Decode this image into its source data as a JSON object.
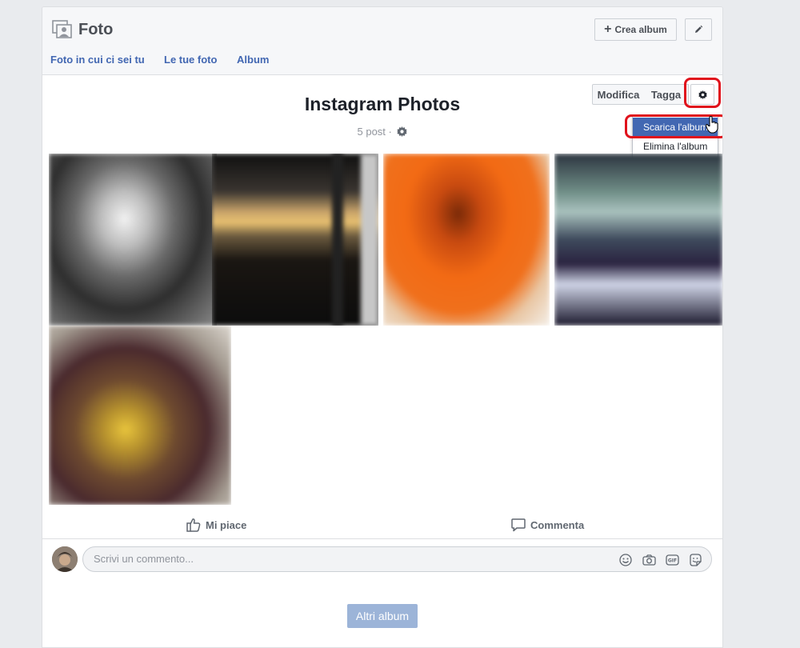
{
  "header": {
    "title": "Foto",
    "photo_icon": "photo-album-icon",
    "create_album_label": "Crea album",
    "edit_icon": "pencil-icon",
    "tabs": [
      {
        "label": "Foto in cui ci sei tu"
      },
      {
        "label": "Le tue foto"
      },
      {
        "label": "Album"
      }
    ]
  },
  "album": {
    "title": "Instagram Photos",
    "post_count": "5 post ·",
    "buttons": {
      "modifica": "Modifica",
      "tagga": "Tagga",
      "settings_icon": "gear-icon"
    },
    "menu": {
      "items": [
        {
          "label": "Scarica l'album"
        },
        {
          "label": "Elimina l'album"
        }
      ]
    },
    "photo_count": 5
  },
  "actions": {
    "like_label": "Mi piace",
    "comment_label": "Commenta"
  },
  "comment": {
    "placeholder": "Scrivi un commento...",
    "icons": [
      "emoji-icon",
      "camera-icon",
      "gif-icon",
      "sticker-icon"
    ]
  },
  "footer": {
    "more_albums_label": "Altri album"
  },
  "colors": {
    "accent": "#4267b2",
    "highlight": "#e0121c",
    "page_bg": "#e9ebee"
  }
}
